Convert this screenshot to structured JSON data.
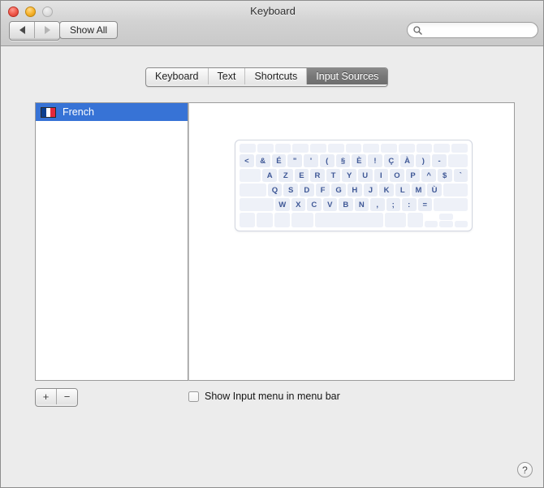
{
  "window": {
    "title": "Keyboard",
    "traffic_lights": [
      "close",
      "minimize",
      "zoom"
    ]
  },
  "toolbar": {
    "back_icon": "triangle-left-icon",
    "forward_icon": "triangle-right-icon",
    "show_all_label": "Show All",
    "search": {
      "value": "",
      "placeholder": "",
      "icon": "search-icon"
    }
  },
  "tabs": [
    {
      "label": "Keyboard",
      "selected": false
    },
    {
      "label": "Text",
      "selected": false
    },
    {
      "label": "Shortcuts",
      "selected": false
    },
    {
      "label": "Input Sources",
      "selected": true
    }
  ],
  "input_sources": {
    "items": [
      {
        "label": "French",
        "flag": "flag-france-icon",
        "selected": true
      }
    ],
    "add_label": "+",
    "remove_label": "−"
  },
  "keyboard_preview": {
    "layout_name": "French",
    "rows": [
      {
        "type": "function",
        "keys": [
          "",
          "",
          "",
          "",
          "",
          "",
          "",
          "",
          "",
          "",
          "",
          "",
          ""
        ]
      },
      {
        "type": "numbers",
        "keys": [
          "<",
          "&",
          "É",
          "\"",
          "'",
          "(",
          "§",
          "È",
          "!",
          "Ç",
          "À",
          ")",
          "-",
          ""
        ]
      },
      {
        "type": "upper",
        "keys": [
          "",
          "A",
          "Z",
          "E",
          "R",
          "T",
          "Y",
          "U",
          "I",
          "O",
          "P",
          "^",
          "$",
          "`"
        ]
      },
      {
        "type": "home",
        "keys": [
          "",
          "Q",
          "S",
          "D",
          "F",
          "G",
          "H",
          "J",
          "K",
          "L",
          "M",
          "Ù",
          ""
        ]
      },
      {
        "type": "lower",
        "keys": [
          "",
          "W",
          "X",
          "C",
          "V",
          "B",
          "N",
          ",",
          ";",
          ":",
          "=",
          ""
        ]
      },
      {
        "type": "modifiers",
        "keys": [
          "",
          "",
          "",
          "",
          "",
          "",
          "",
          "",
          "",
          ""
        ]
      }
    ]
  },
  "options": {
    "show_input_menu": {
      "label": "Show Input menu in menu bar",
      "checked": false
    }
  },
  "help": {
    "label": "?"
  },
  "colors": {
    "selection_blue": "#3773d6",
    "tab_selected_gray": "#777777",
    "key_fill": "#e9edf6",
    "key_text": "#3f5896",
    "window_chrome": "#ececec"
  }
}
